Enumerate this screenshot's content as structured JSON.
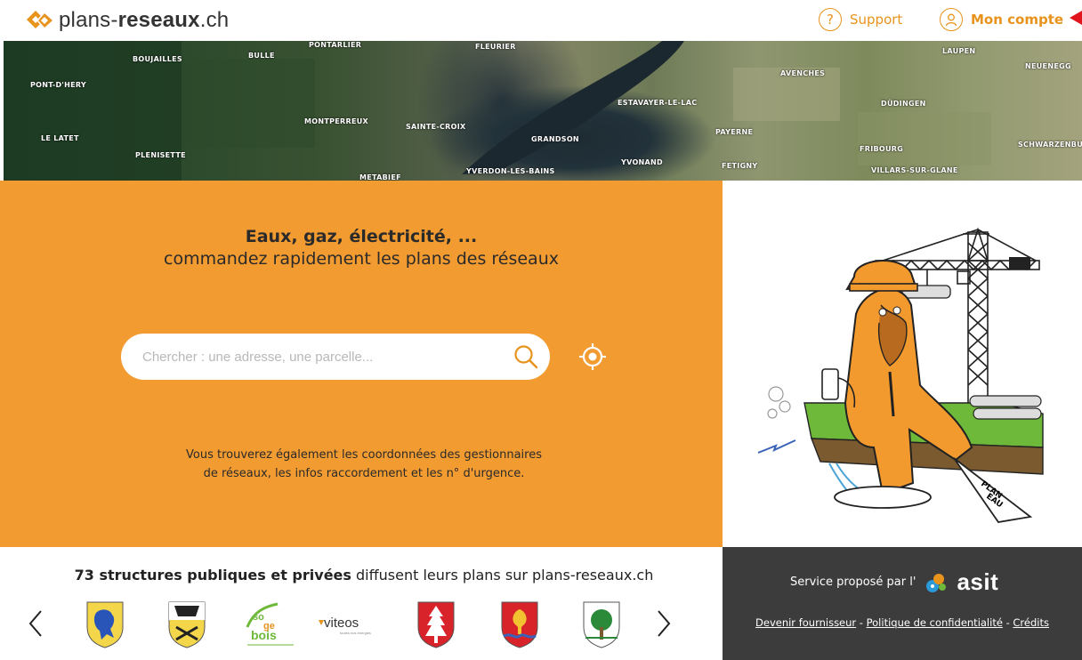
{
  "header": {
    "logo_prefix": "plans-",
    "logo_bold": "reseaux",
    "logo_suffix": ".ch",
    "support_label": "Support",
    "account_label": "Mon compte"
  },
  "banner": {
    "places": [
      "PONTARLIER",
      "FLEURIER",
      "BOUJAILLES",
      "BULLE",
      "PONT-D'HERY",
      "MONTPERREUX",
      "LE LATET",
      "PLENISETTE",
      "SAINTE-CROIX",
      "GRANDSON",
      "ESTAVAYER-LE-LAC",
      "AVENCHES",
      "LAUPEN",
      "NEUENEGG",
      "DÜDINGEN",
      "PAYERNE",
      "FRIBOURG",
      "SCHWARZENBU",
      "YVONAND",
      "YVERDON-LES-BAINS",
      "FETIGNY",
      "VILLARS-SUR-GLANE",
      "METABIEF"
    ]
  },
  "hero": {
    "title_line1": "Eaux, gaz, électricité, ...",
    "title_line2": "commandez rapidement les plans des réseaux",
    "search_placeholder": "Chercher : une adresse, une parcelle...",
    "subtext_line1": "Vous trouverez également les coordonnées des gestionnaires",
    "subtext_line2": "de réseaux, les infos raccordement et les n° d'urgence."
  },
  "providers": {
    "count_bold": "73 structures publiques et privées",
    "count_rest": " diffusent leurs plans sur plans-reseaux.ch",
    "logos": [
      {
        "name": "coat-of-arms-lion",
        "color": "#f4d64a",
        "accent": "#2a55b8"
      },
      {
        "name": "coat-of-arms-bear",
        "color": "#f4d64a",
        "accent": "#222222"
      },
      {
        "name": "sogebois-logo",
        "text": "soge bois"
      },
      {
        "name": "viteos-logo",
        "text": "viteos"
      },
      {
        "name": "coat-of-arms-fir",
        "color": "#d8232a",
        "accent": "#ffffff"
      },
      {
        "name": "coat-of-arms-tree-red",
        "color": "#d8232a",
        "accent": "#f2c230"
      },
      {
        "name": "coat-of-arms-tree-green",
        "color": "#ffffff",
        "accent": "#2a8a3a"
      }
    ]
  },
  "footer": {
    "service_label": "Service proposé par l'",
    "asit_label": "asit",
    "link_provider": "Devenir fournisseur",
    "link_privacy": "Politique de confidentialité",
    "link_credits": "Crédits",
    "separator": " - "
  },
  "colors": {
    "orange": "#f29b30",
    "accent": "#e8931c",
    "dark_footer": "#3c3c3c",
    "red_arrow": "#e2141e"
  },
  "illustration": {
    "sign_text_1": "PLAN",
    "sign_text_2": "EAU"
  }
}
